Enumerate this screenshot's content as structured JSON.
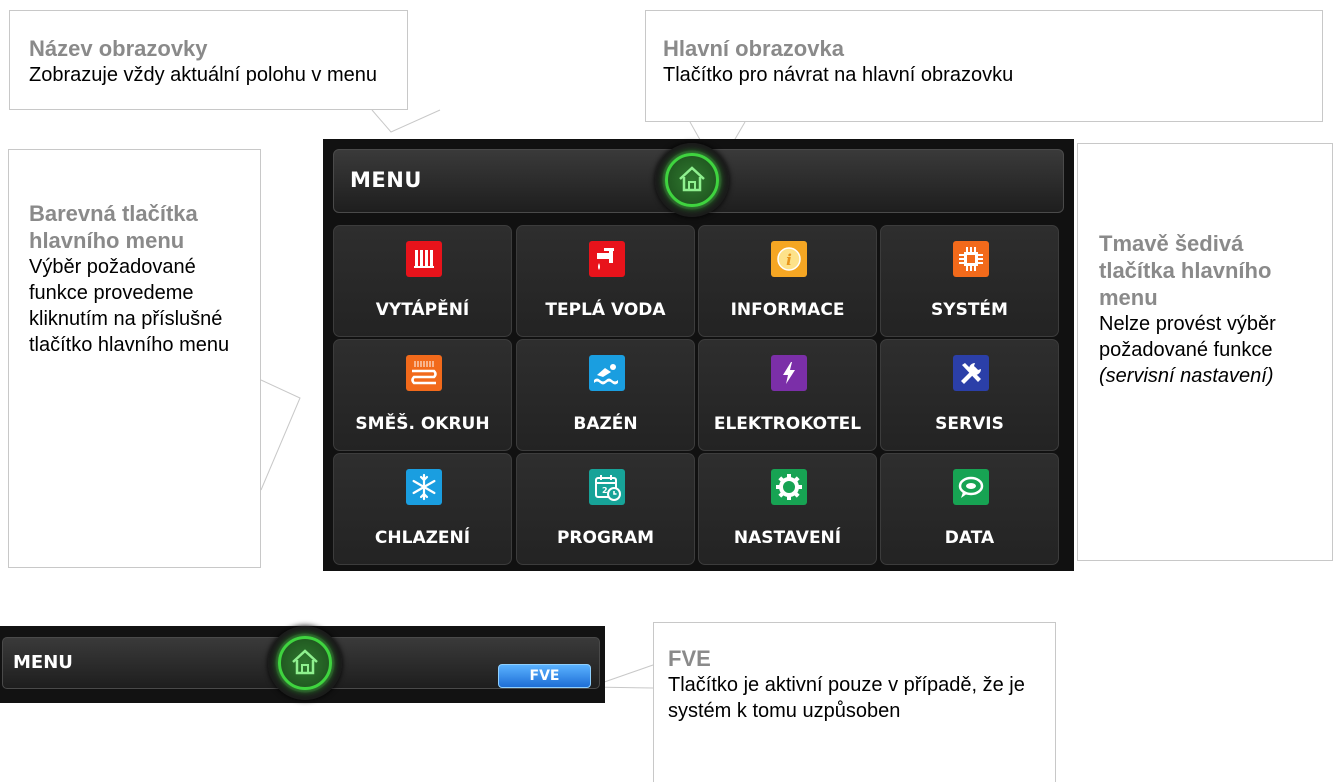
{
  "callouts": {
    "screen_name": {
      "title": "Název obrazovky",
      "text": "Zobrazuje vždy aktuální polohu v menu"
    },
    "home": {
      "title": "Hlavní obrazovka",
      "text": "Tlačítko pro návrat na hlavní obrazovku"
    },
    "colored": {
      "title": "Barevná tlačítka hlavního menu",
      "text": "Výběr požadované funkce provedeme kliknutím na příslušné tlačítko hlavního menu"
    },
    "grey": {
      "title": "Tmavě šedivá tlačítka hlavního menu",
      "text": "Nelze provést výběr požadované funkce",
      "note": "(servisní nastavení)"
    },
    "fve": {
      "title": "FVE",
      "text": "Tlačítko je aktivní pouze v případě, že je systém k tomu uzpůsoben"
    }
  },
  "menu": {
    "title": "MENU",
    "tiles": [
      {
        "label": "VYTÁPĚNÍ",
        "icon": "radiator-icon",
        "color": "#e8131b"
      },
      {
        "label": "TEPLÁ VODA",
        "icon": "tap-icon",
        "color": "#e8131b"
      },
      {
        "label": "INFORMACE",
        "icon": "info-icon",
        "color": "#f5a623"
      },
      {
        "label": "SYSTÉM",
        "icon": "chip-icon",
        "color": "#f26a1b"
      },
      {
        "label": "SMĚŠ. OKRUH",
        "icon": "floor-heating-icon",
        "color": "#f26a1b"
      },
      {
        "label": "BAZÉN",
        "icon": "swimmer-icon",
        "color": "#1a9ee0"
      },
      {
        "label": "ELEKTROKOTEL",
        "icon": "lightning-icon",
        "color": "#7b2fa8"
      },
      {
        "label": "SERVIS",
        "icon": "tools-icon",
        "color": "#2b3fa8"
      },
      {
        "label": "CHLAZENÍ",
        "icon": "snowflake-icon",
        "color": "#1a9ee0"
      },
      {
        "label": "PROGRAM",
        "icon": "calendar-clock-icon",
        "color": "#17a398"
      },
      {
        "label": "NASTAVENÍ",
        "icon": "gear-icon",
        "color": "#17a353"
      },
      {
        "label": "DATA",
        "icon": "chat-icon",
        "color": "#17a353"
      }
    ]
  },
  "menu_bar2": {
    "title": "MENU",
    "fve_label": "FVE"
  },
  "colors": {
    "home_ring": "#3fd43f",
    "fve_button": "#2e8cf0"
  }
}
